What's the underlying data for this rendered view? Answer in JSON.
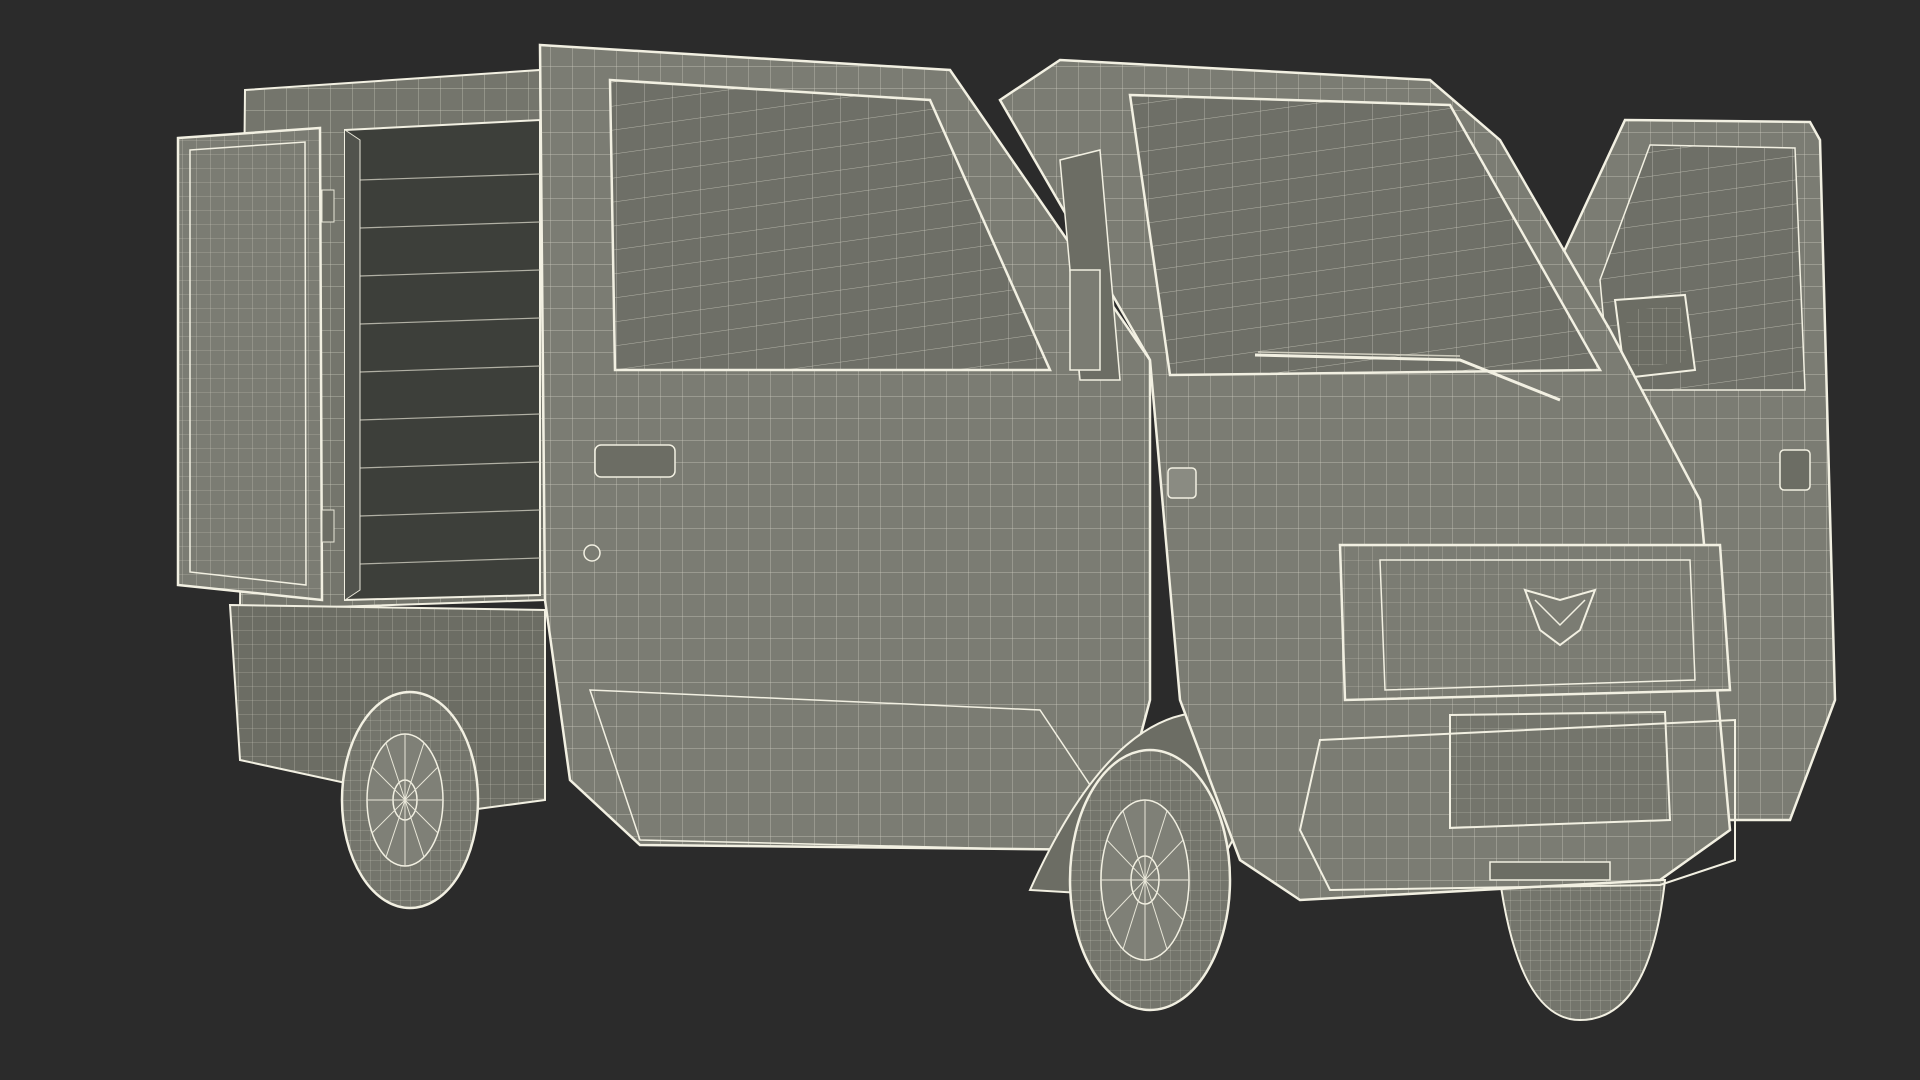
{
  "scene": {
    "background": "#2b2b2b",
    "subject": "van-wireframe",
    "colors": {
      "body": "#7b7c73",
      "body_dark": "#6c6d64",
      "glass": "#6e6f67",
      "interior": "#3d3f3a",
      "tire": "#74756c",
      "wire": "#e8e6d8",
      "edge": "#f2f0e2"
    }
  }
}
